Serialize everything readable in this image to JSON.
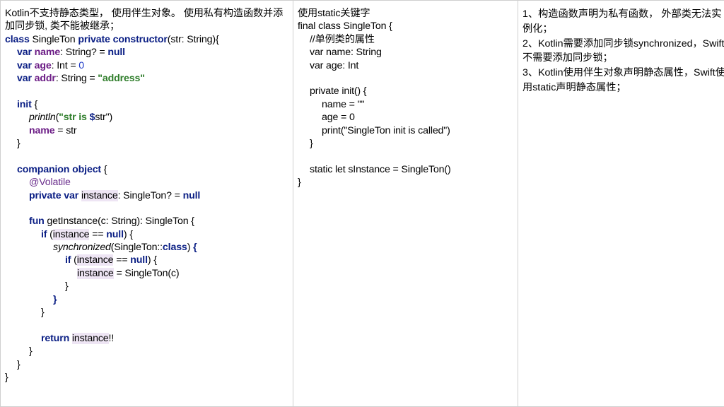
{
  "kotlin": {
    "intro": "Kotlin不支持静态类型， 使用伴生对象。 使用私有构造函数并添加同步锁, 类不能被继承；",
    "l_class": [
      "class",
      " SingleTon ",
      "private",
      " ",
      "constructor",
      "(str: String){"
    ],
    "l_name": [
      "var",
      " ",
      "name",
      ": String? = ",
      "null"
    ],
    "l_age": [
      "var",
      " ",
      "age",
      ": Int = ",
      "0"
    ],
    "l_addr": [
      "var",
      " ",
      "addr",
      ": String = ",
      "\"address\""
    ],
    "l_init": [
      "init",
      " {"
    ],
    "l_println": [
      "println",
      "(",
      "\"str is ",
      "$",
      "str\")"
    ],
    "l_assign": [
      "name",
      " = str"
    ],
    "l_close1": "}",
    "l_companion": [
      "companion",
      " ",
      "object",
      " {"
    ],
    "l_volatile": "@Volatile",
    "l_instance": [
      "private",
      " ",
      "var",
      " ",
      "instance",
      ": SingleTon? = ",
      "null"
    ],
    "l_fun": [
      "fun",
      " getInstance(c: String): SingleTon {"
    ],
    "l_if1": [
      "if",
      " (",
      "instance",
      " == ",
      "null",
      ") {"
    ],
    "l_sync": [
      "synchronized",
      "(SingleTon::",
      "class",
      ") ",
      "{"
    ],
    "l_if2": [
      "if",
      " (",
      "instance",
      " == ",
      "null",
      ") {"
    ],
    "l_new": [
      "instance",
      " = SingleTon(c)"
    ],
    "l_close2": "}",
    "l_close3": "}",
    "l_close4": "}",
    "l_return": [
      "return",
      " ",
      "instance",
      "!!"
    ],
    "l_close5": "}",
    "l_close6": "}",
    "l_close7": "}"
  },
  "swift": {
    "l1": "使用static关键字",
    "l2": "final class SingleTon {",
    "l3": "//单例类的属性",
    "l4": "var name: String",
    "l5": "var age: Int",
    "l6": "private init() {",
    "l7": "name = \"\"",
    "l8": "age = 0",
    "l9": "print(\"SingleTon init is called\")",
    "l10": "}",
    "l11": "static let sInstance = SingleTon()",
    "l12": "}"
  },
  "notes": {
    "n1": "1、构造函数声明为私有函数， 外部类无法实例化；",
    "n2": "2、Kotlin需要添加同步锁synchronized，Swift不需要添加同步锁；",
    "n3": "3、Kotlin使用伴生对象声明静态属性，Swift使用static声明静态属性；"
  }
}
